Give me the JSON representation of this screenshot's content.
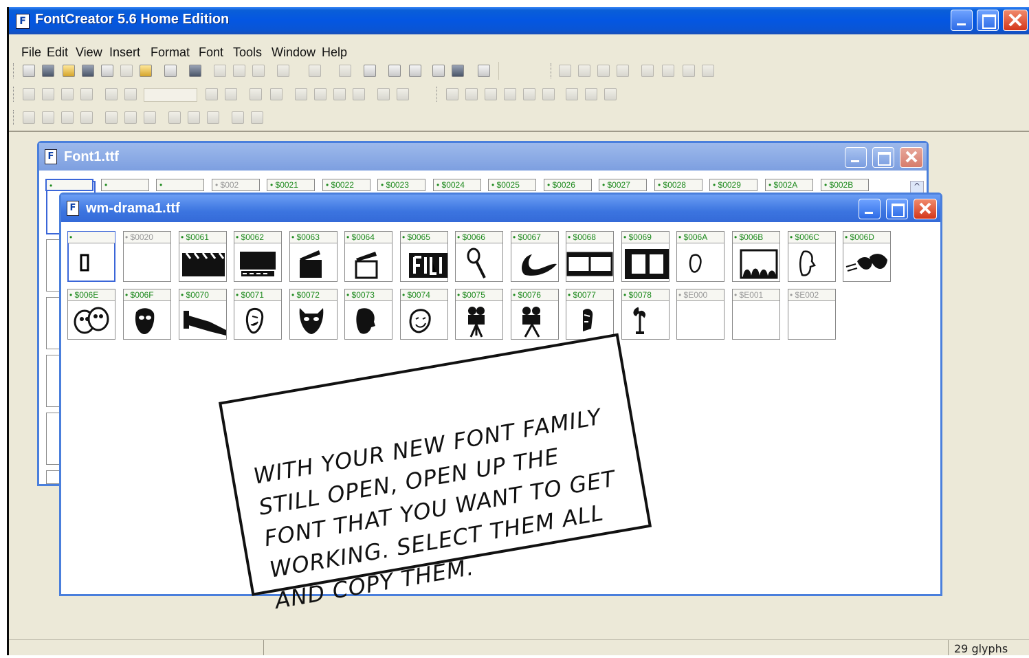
{
  "app": {
    "title": "FontCreator 5.6 Home Edition",
    "menu": [
      "File",
      "Edit",
      "View",
      "Insert",
      "Format",
      "Font",
      "Tools",
      "Window",
      "Help"
    ],
    "status_glyphs": "29 glyphs"
  },
  "font1": {
    "title": "Font1.ttf",
    "top_labels": [
      "•",
      "•",
      "•",
      "• $002",
      "• $0021",
      "• $0022",
      "• $0023",
      "• $0024",
      "• $0025",
      "• $0026",
      "• $0027",
      "• $0028",
      "• $0029",
      "• $002A",
      "• $002B"
    ]
  },
  "drama": {
    "title": "wm-drama1.ttf",
    "row1": [
      "•",
      "• $0020",
      "• $0061",
      "• $0062",
      "• $0063",
      "• $0064",
      "• $0065",
      "• $0066",
      "• $0067",
      "• $0068",
      "• $0069",
      "• $006A",
      "• $006B",
      "• $006C",
      "• $006D"
    ],
    "row2": [
      "• $006E",
      "• $006F",
      "• $0070",
      "• $0071",
      "• $0072",
      "• $0073",
      "• $0074",
      "• $0075",
      "• $0076",
      "• $0077",
      "• $0078",
      "• $E000",
      "• $E001",
      "• $E002"
    ]
  },
  "caption": {
    "lines": [
      "WITH YOUR NEW FONT FAMILY",
      "STILL OPEN, OPEN UP THE",
      "FONT THAT YOU WANT TO GET",
      "WORKING. SELECT THEM ALL",
      "AND COPY THEM."
    ]
  }
}
